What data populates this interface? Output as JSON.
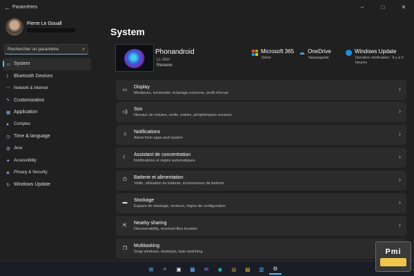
{
  "window": {
    "back_icon": "back-arrow-icon",
    "title": "Paramètres",
    "controls": [
      "–",
      "□",
      "✕"
    ]
  },
  "profile": {
    "name": "Pierre Le Gouall"
  },
  "search": {
    "placeholder": "Rechercher un paramètre",
    "icon": "search-icon"
  },
  "nav": {
    "accent": "#4cc2ff",
    "items": [
      {
        "label": "System",
        "icon": "monitor-icon",
        "active": true
      },
      {
        "label": "Bluetooth Devices",
        "icon": "bluetooth-icon"
      },
      {
        "label": "Network & internet",
        "icon": "wifi-icon"
      },
      {
        "label": "Customization",
        "icon": "brush-icon"
      },
      {
        "label": "Application",
        "icon": "apps-icon"
      },
      {
        "label": "Comptes",
        "icon": "person-icon"
      },
      {
        "label": "Time & language",
        "icon": "clock-icon"
      },
      {
        "label": "Jeux",
        "icon": "gamepad-icon"
      },
      {
        "label": "Accessibility",
        "icon": "accessibility-icon"
      },
      {
        "label": "Privacy & Security",
        "icon": "shield-icon"
      },
      {
        "label": "Windows Update",
        "icon": "update-icon"
      }
    ]
  },
  "main": {
    "title": "System",
    "device": {
      "name": "Phonandroid",
      "subtitle": "LL-Win",
      "rename": "Rename"
    },
    "quick": [
      {
        "title": "Microsoft 365",
        "sub": "Gérer",
        "icon": "microsoft-logo-icon"
      },
      {
        "title": "OneDrive",
        "sub": "Sauvegarde",
        "icon": "cloud-icon"
      },
      {
        "title": "Windows Update",
        "sub": "Dernière vérification : Il y a 2",
        "sub2": "heures",
        "icon": "update-icon"
      }
    ],
    "cards": [
      {
        "title": "Display",
        "sub": "Moniteurs, luminosité, éclairage nocturne, profil d'écran",
        "icon": "display-icon"
      },
      {
        "title": "Son",
        "sub": "Niveaux de volume, sortie, entrée, périphériques sonores",
        "icon": "speaker-icon"
      },
      {
        "title": "Notifications",
        "sub": "Alerts from apps and system",
        "icon": "bell-icon"
      },
      {
        "title": "Assistant de concentration",
        "sub": "Notifications et règles automatiques",
        "icon": "moon-icon"
      },
      {
        "title": "Batterie et alimentation",
        "sub": "Veille, utilisation de batterie, économiseur de batterie",
        "icon": "power-icon"
      },
      {
        "title": "Stockage",
        "sub": "Espace de stockage, lecteurs, règles de configuration",
        "icon": "storage-icon"
      },
      {
        "title": "Nearby sharing",
        "sub": "Discoverability, received files location",
        "icon": "share-icon"
      },
      {
        "title": "Multitasking",
        "sub": "Snap windows, desktops, task switching",
        "icon": "multitask-icon"
      }
    ]
  },
  "taskbar": {
    "icons": [
      "windows-start-icon",
      "search-icon",
      "task-view-icon",
      "widgets-icon",
      "chat-icon",
      "edge-icon",
      "chrome-icon",
      "explorer-icon",
      "store-icon",
      "settings-icon"
    ],
    "glyphs": [
      "⊞",
      "⌕",
      "▣",
      "▦",
      "✉",
      "◉",
      "◎",
      "▤",
      "▥",
      "⚙"
    ],
    "active_index": 9,
    "tray": [
      "^",
      "☁",
      "🔊",
      "🔋"
    ]
  },
  "watermark": {
    "text": "Pmi"
  }
}
